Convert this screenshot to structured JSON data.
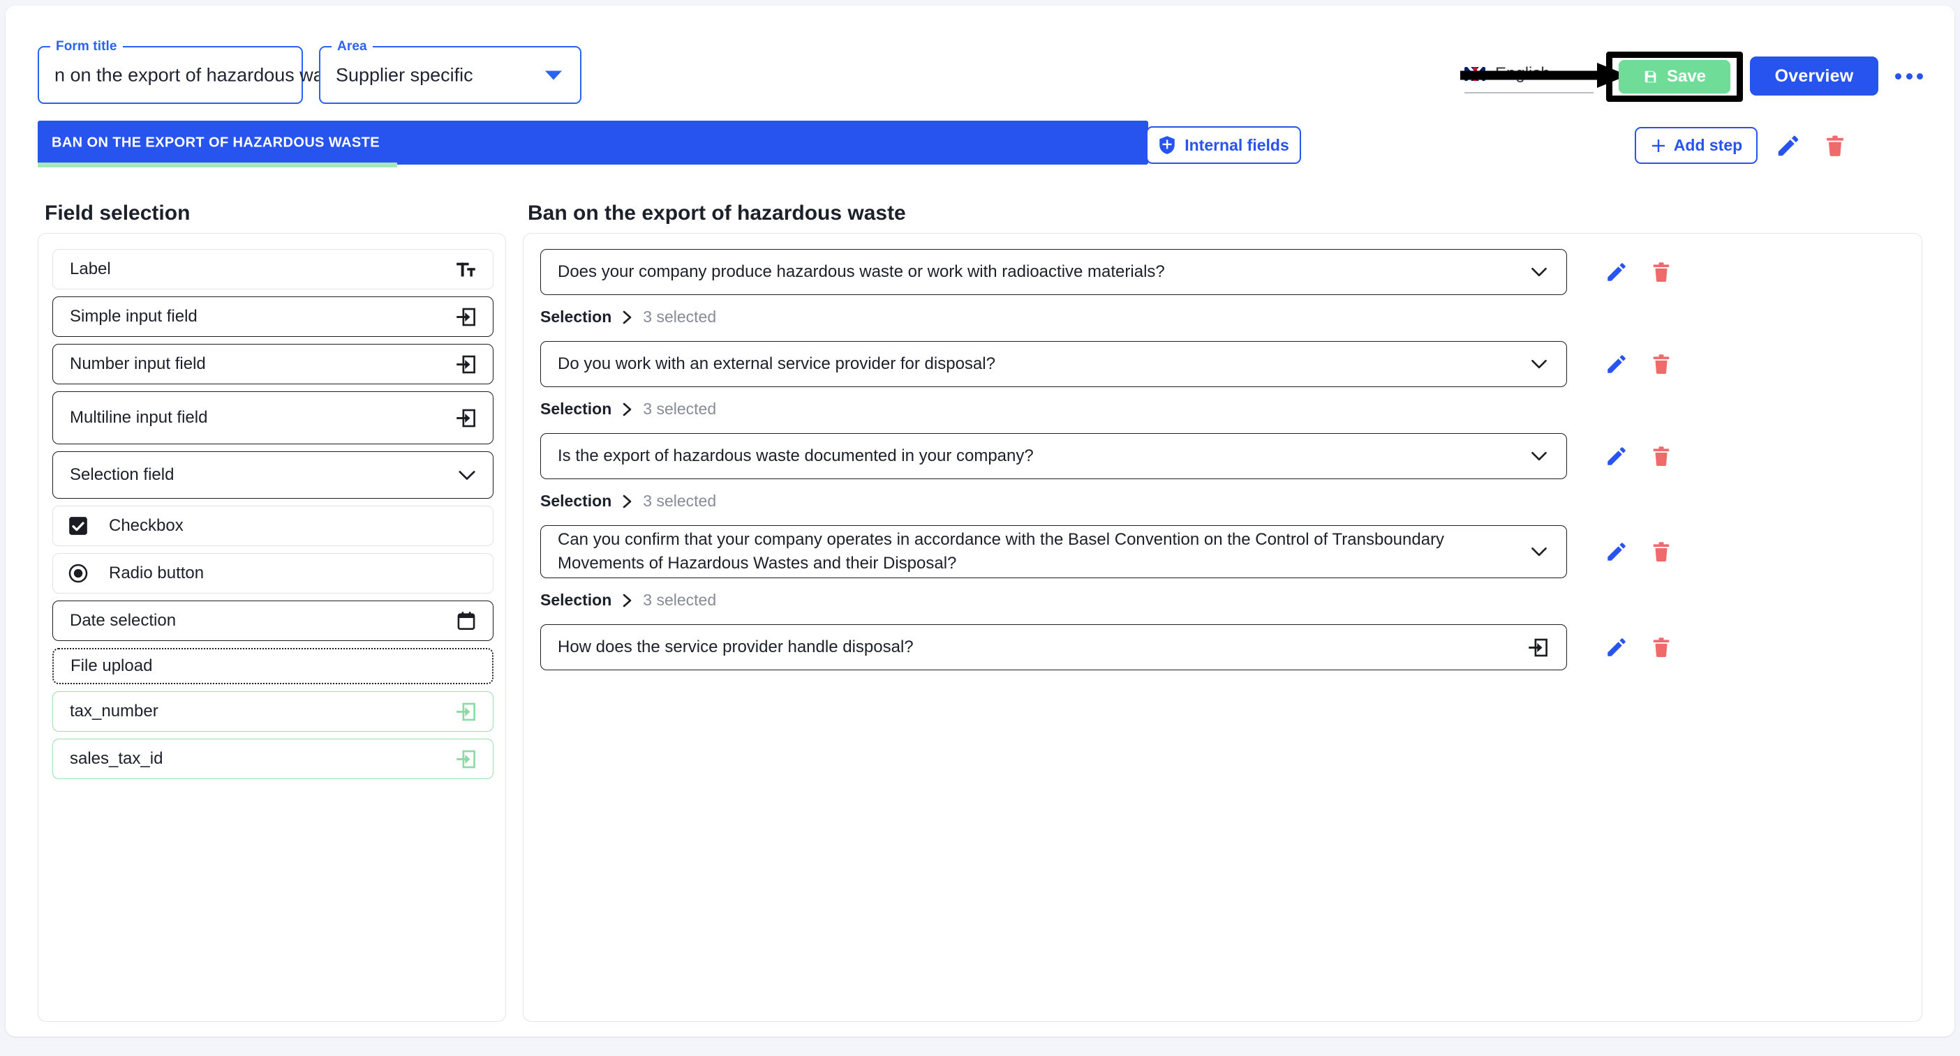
{
  "topbar": {
    "form_title": {
      "legend": "Form title",
      "value": "n on the export of hazardous waste"
    },
    "area": {
      "legend": "Area",
      "value": "Supplier specific"
    },
    "language": {
      "label": "English",
      "flag_icon": "uk-flag-icon",
      "chevron_icon": "chevron-down-icon"
    },
    "save_label": "Save",
    "save_icon": "save-disk-icon",
    "save_color": "#6fdd98",
    "overview_label": "Overview",
    "overview_color": "#2753ef",
    "more_icon": "kebab-menu-icon",
    "annotation_icon": "arrow-annotation-icon"
  },
  "steps_bar": {
    "active_tab": "BAN ON THE EXPORT OF HAZARDOUS WASTE",
    "tab_color": "#2753ef",
    "tab_underline_color": "#a6e6bd",
    "internal_fields_label": "Internal fields",
    "internal_fields_icon": "shield-icon",
    "add_step_label": "Add step",
    "add_step_icon": "plus-icon",
    "edit_icon": "pencil-icon",
    "delete_icon": "trash-icon"
  },
  "field_selection": {
    "title": "Field selection",
    "items": [
      {
        "label": "Label",
        "icon": "text-format-icon",
        "style": "soft",
        "icon_side": "right",
        "height": 58
      },
      {
        "label": "Simple input field",
        "icon": "input-field-icon",
        "style": "solid",
        "icon_side": "right",
        "height": 58
      },
      {
        "label": "Number input field",
        "icon": "input-field-icon",
        "style": "solid",
        "icon_side": "right",
        "height": 58
      },
      {
        "label": "Multiline input field",
        "icon": "input-field-icon",
        "style": "solid",
        "icon_side": "right",
        "height": 76
      },
      {
        "label": "Selection field",
        "icon": "chevron-down-icon",
        "style": "solid",
        "icon_side": "right",
        "height": 68
      },
      {
        "label": "Checkbox",
        "icon": "checkbox-checked-icon",
        "style": "soft",
        "icon_side": "left",
        "height": 58
      },
      {
        "label": "Radio button",
        "icon": "radio-selected-icon",
        "style": "soft",
        "icon_side": "left",
        "height": 58
      },
      {
        "label": "Date selection",
        "icon": "calendar-icon",
        "style": "solid",
        "icon_side": "right",
        "height": 58
      },
      {
        "label": "File upload",
        "icon": "none",
        "style": "dashed",
        "icon_side": "right",
        "height": 52
      },
      {
        "label": "tax_number",
        "icon": "input-field-icon-green",
        "style": "green",
        "icon_side": "right",
        "height": 58
      },
      {
        "label": "sales_tax_id",
        "icon": "input-field-icon-green",
        "style": "green",
        "icon_side": "right",
        "height": 58
      }
    ]
  },
  "section": {
    "title": "Ban on the export of hazardous waste",
    "questions": [
      {
        "text": "Does your company produce hazardous waste or work with radioactive materials?",
        "field_icon": "chevron-down-icon",
        "selection": {
          "label": "Selection",
          "separator_icon": "chevron-right-icon",
          "count": "3 selected"
        },
        "edit_icon": "pencil-icon",
        "delete_icon": "trash-icon"
      },
      {
        "text": "Do you work with an external service provider for disposal?",
        "field_icon": "chevron-down-icon",
        "selection": {
          "label": "Selection",
          "separator_icon": "chevron-right-icon",
          "count": "3 selected"
        },
        "edit_icon": "pencil-icon",
        "delete_icon": "trash-icon"
      },
      {
        "text": "Is the export of hazardous waste documented in your company?",
        "field_icon": "chevron-down-icon",
        "selection": {
          "label": "Selection",
          "separator_icon": "chevron-right-icon",
          "count": "3 selected"
        },
        "edit_icon": "pencil-icon",
        "delete_icon": "trash-icon"
      },
      {
        "text": "Can you confirm that your company operates in accordance with the Basel Convention on the Control of Transboundary Movements of Hazardous Wastes and their Disposal?",
        "field_icon": "chevron-down-icon",
        "selection": {
          "label": "Selection",
          "separator_icon": "chevron-right-icon",
          "count": "3 selected"
        },
        "edit_icon": "pencil-icon",
        "delete_icon": "trash-icon"
      },
      {
        "text": "How does the service provider handle disposal?",
        "field_icon": "input-field-icon",
        "selection": null,
        "edit_icon": "pencil-icon",
        "delete_icon": "trash-icon"
      }
    ]
  }
}
